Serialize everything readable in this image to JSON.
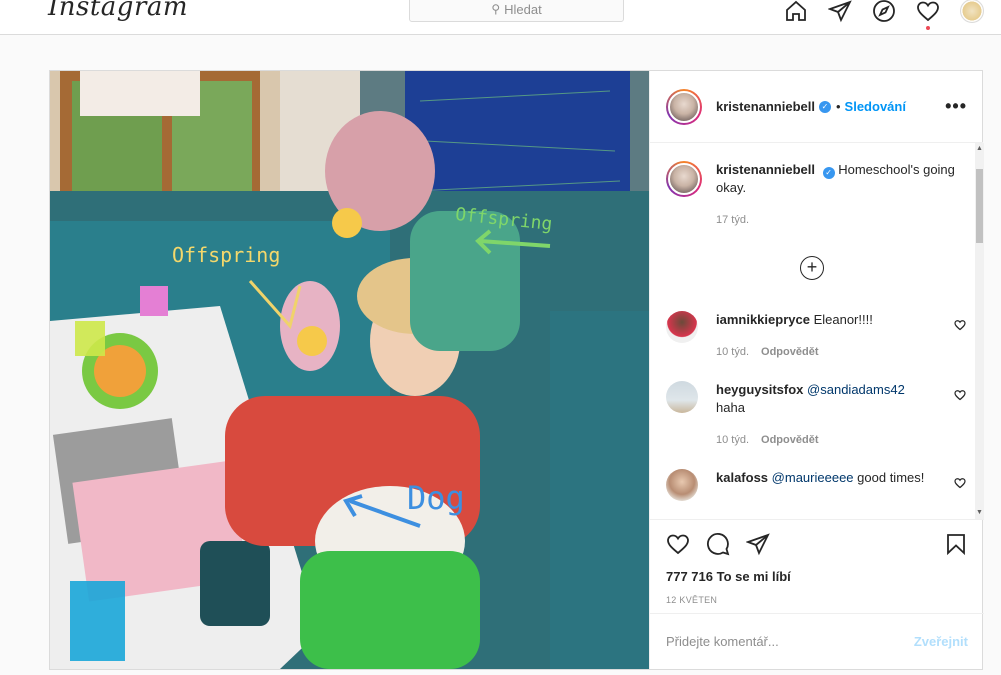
{
  "nav": {
    "logo": "Instagram",
    "search_placeholder": "Hledat",
    "icons": [
      "home-icon",
      "direct-icon",
      "explore-icon",
      "activity-heart-icon",
      "profile-avatar"
    ]
  },
  "post": {
    "username": "kristenanniebell",
    "follow_label": "Sledování",
    "more_label": "•••",
    "photo_overlays": {
      "offspring_left": "Offspring",
      "offspring_right": "Offspring",
      "dog": "Dog"
    },
    "caption": {
      "username": "kristenanniebell",
      "text": "Homeschool's going okay.",
      "time": "17 týd."
    },
    "load_more": "+",
    "comments": [
      {
        "username": "iamnikkiepryce",
        "text": "Eleanor!!!!",
        "time": "10 týd.",
        "reply": "Odpovědět"
      },
      {
        "username": "heyguysitsfox",
        "mention": "@sandiadams42",
        "text": "haha",
        "time": "10 týd.",
        "reply": "Odpovědět"
      },
      {
        "username": "kalafoss",
        "mention": "@maurieeeee",
        "text": "good times!"
      }
    ],
    "likes": "777 716 To se mi líbí",
    "date": "12 KVĚTEN",
    "add_comment_placeholder": "Přidejte komentář...",
    "publish_label": "Zveřejnit"
  },
  "colors": {
    "accent": "#0095f6",
    "border": "#dbdbdb",
    "notification": "#ed4956"
  }
}
